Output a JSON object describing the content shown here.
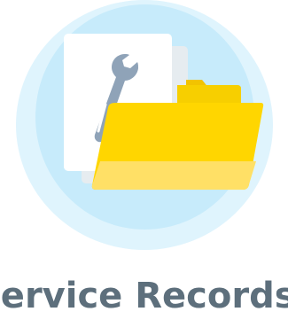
{
  "heading": {
    "text": "Service Records Manager"
  },
  "illustration": {
    "icons": [
      "document-icon",
      "wrench-icon",
      "folder-icon"
    ],
    "colors": {
      "halo_outer": "#dff4fd",
      "halo_inner": "#c7ebfb",
      "folder_top": "#ffd600",
      "folder_bottom": "#ffe066",
      "paper": "#ffffff",
      "wrench": "#8fa3b8",
      "text": "#5d6f7c"
    }
  }
}
